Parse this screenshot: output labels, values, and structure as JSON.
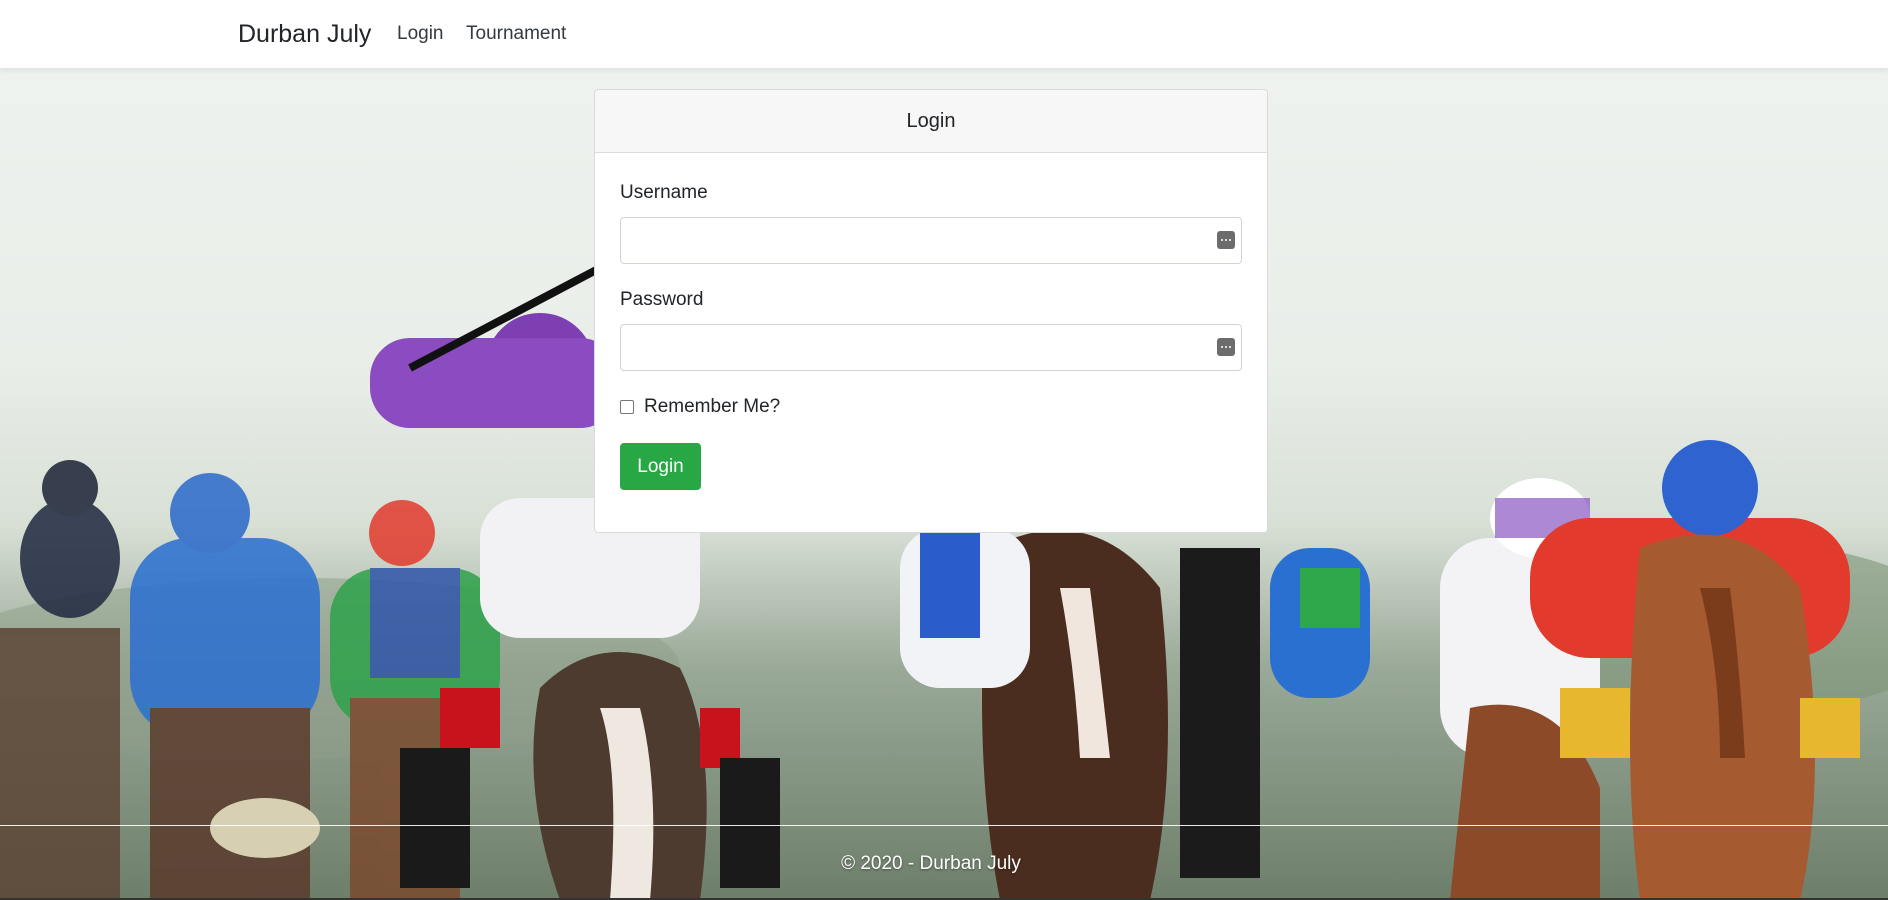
{
  "navbar": {
    "brand": "Durban July",
    "links": [
      {
        "label": "Login"
      },
      {
        "label": "Tournament"
      }
    ]
  },
  "login_card": {
    "title": "Login",
    "username_label": "Username",
    "username_value": "",
    "password_label": "Password",
    "password_value": "",
    "remember_label": "Remember Me?",
    "remember_checked": false,
    "submit_label": "Login"
  },
  "footer": {
    "text": "© 2020 - Durban July"
  },
  "background": {
    "description_icon": "horse-racing-photo"
  },
  "colors": {
    "primary_button": "#28a745",
    "navbar_bg": "#ffffff",
    "card_header_bg": "#f7f7f7"
  }
}
